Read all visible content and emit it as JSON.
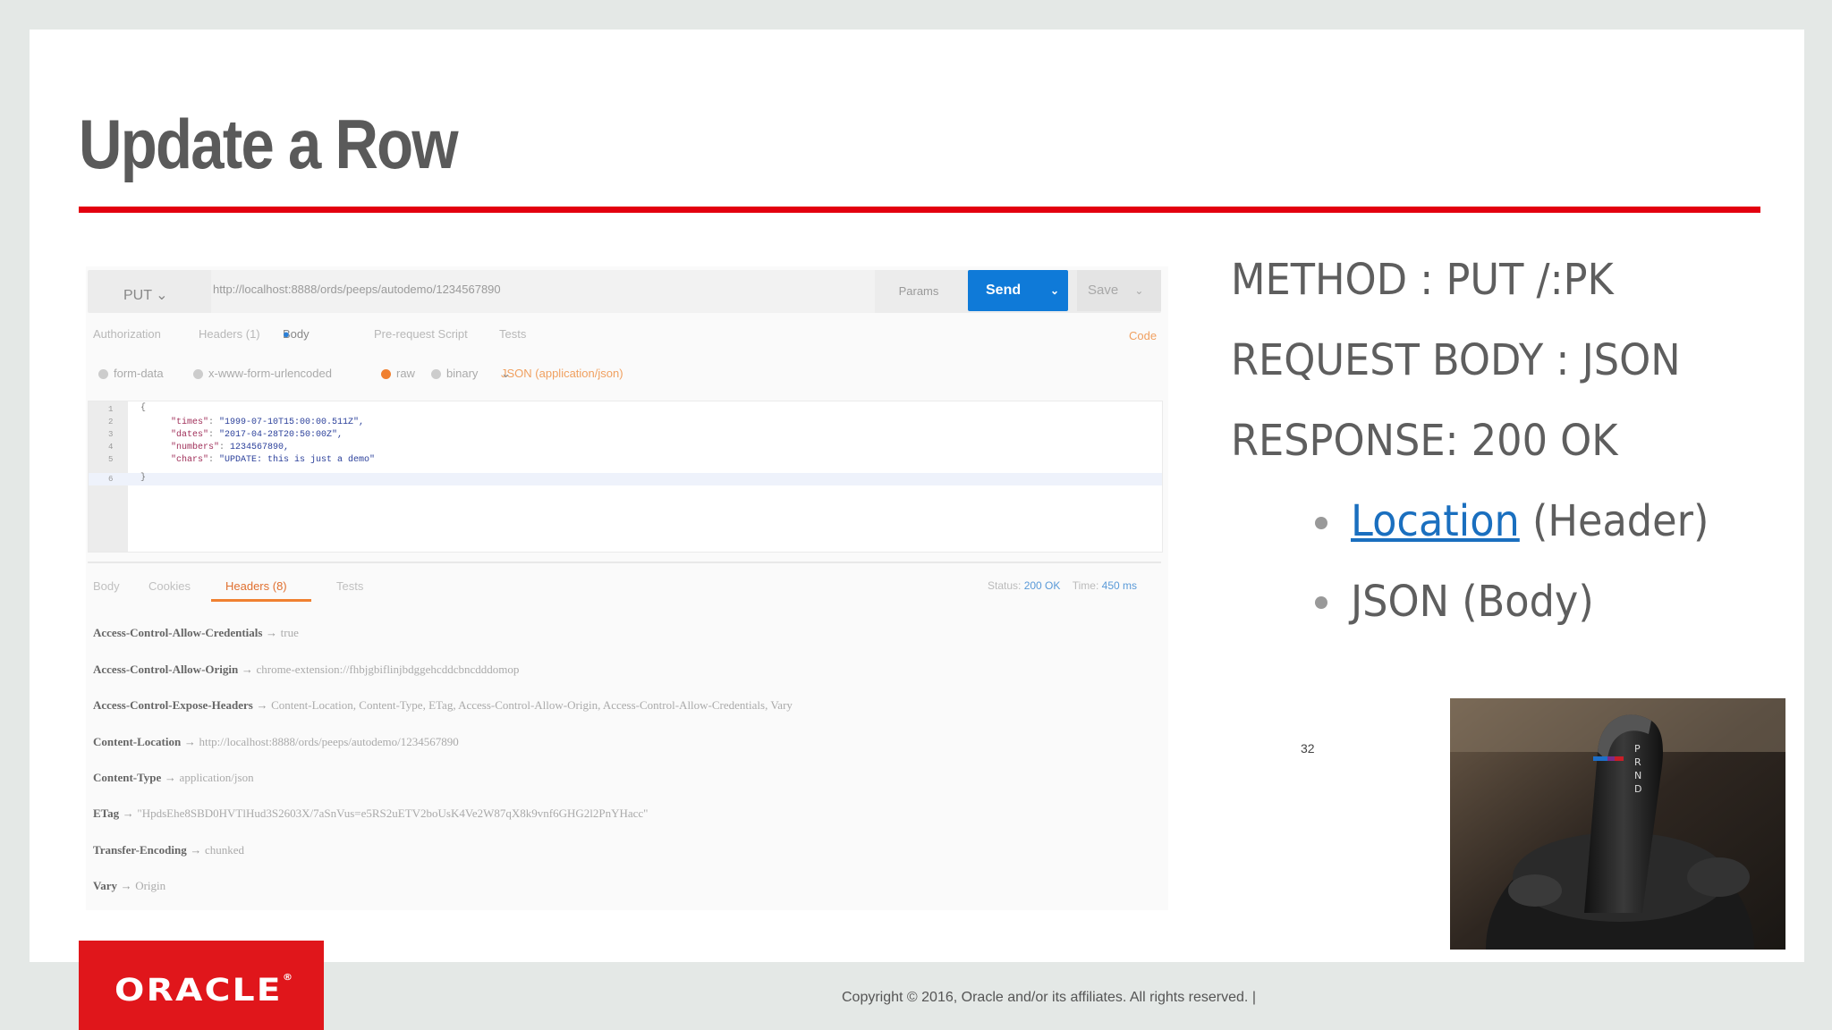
{
  "slide": {
    "title": "Update a Row",
    "page_number": "32",
    "copyright": "Copyright © 2016, Oracle and/or its affiliates. All rights reserved.  |",
    "brand": "ORACLE",
    "brand_mark": "®"
  },
  "bullets": {
    "method": "METHOD : PUT /:PK",
    "request_body": "REQUEST BODY : JSON",
    "response": "RESPONSE: 200 OK",
    "sub1_link": "Location",
    "sub1_rest": " (Header)",
    "sub2": "JSON (Body)"
  },
  "postman": {
    "method": "PUT",
    "url": "http://localhost:8888/ords/peeps/autodemo/1234567890",
    "params_label": "Params",
    "send_label": "Send",
    "save_label": "Save",
    "request_tabs": [
      "Authorization",
      "Headers (1)",
      "Body",
      "Pre-request Script",
      "Tests"
    ],
    "code_link": "Code",
    "body_options": [
      "form-data",
      "x-www-form-urlencoded",
      "raw",
      "binary"
    ],
    "content_type": "JSON (application/json)",
    "code_lines": [
      {
        "n": "1",
        "text": "{"
      },
      {
        "n": "2",
        "key": "\"times\"",
        "val": "\"1999-07-10T15:00:00.511Z\","
      },
      {
        "n": "3",
        "key": "\"dates\"",
        "val": "\"2017-04-28T20:50:00Z\","
      },
      {
        "n": "4",
        "key": "\"numbers\"",
        "val": "1234567890,"
      },
      {
        "n": "5",
        "key": "\"chars\"",
        "val": "\"UPDATE: this is just a demo\""
      },
      {
        "n": "6",
        "text": "}"
      }
    ],
    "response_tabs": [
      "Body",
      "Cookies",
      "Headers (8)",
      "Tests"
    ],
    "status_label": "Status:",
    "status_value": "200 OK",
    "time_label": "Time:",
    "time_value": "450 ms",
    "headers": [
      {
        "key": "Access-Control-Allow-Credentials",
        "value": "true"
      },
      {
        "key": "Access-Control-Allow-Origin",
        "value": "chrome-extension://fhbjgbiflinjbdggehcddcbncdddomop"
      },
      {
        "key": "Access-Control-Expose-Headers",
        "value": "Content-Location, Content-Type, ETag, Access-Control-Allow-Origin, Access-Control-Allow-Credentials, Vary"
      },
      {
        "key": "Content-Location",
        "value": "http://localhost:8888/ords/peeps/autodemo/1234567890"
      },
      {
        "key": "Content-Type",
        "value": "application/json"
      },
      {
        "key": "ETag",
        "value": "\"HpdsEhe8SBD0HVTlHud3S2603X/7aSnVus=e5RS2uETV2boUsK4Ve2W87qX8k9vnf6GHG2l2PnYHacc\""
      },
      {
        "key": "Transfer-Encoding",
        "value": "chunked"
      },
      {
        "key": "Vary",
        "value": "Origin"
      }
    ]
  },
  "colors": {
    "accent_red": "#e3000f",
    "send_blue": "#0f7ad8",
    "link_blue": "#1a6fbf"
  }
}
